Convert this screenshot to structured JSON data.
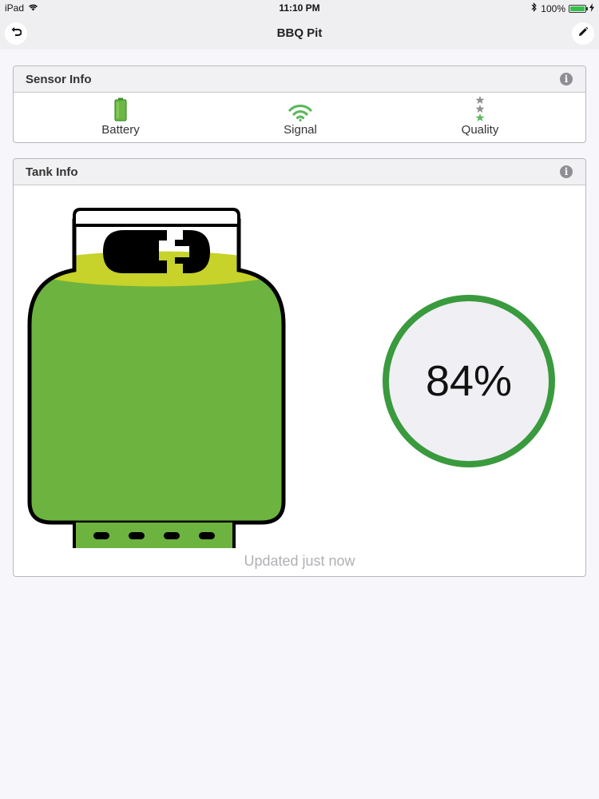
{
  "status_bar": {
    "device": "iPad",
    "time": "11:10 PM",
    "battery_percent": "100%",
    "icons": [
      "wifi-icon",
      "bluetooth-icon",
      "battery-icon",
      "charging-icon"
    ]
  },
  "nav": {
    "title": "BBQ Pit",
    "left_icon": "back-icon",
    "right_icon": "edit-pencil-icon"
  },
  "sensor_info": {
    "title": "Sensor Info",
    "items": [
      {
        "label": "Battery",
        "icon": "battery-level-icon"
      },
      {
        "label": "Signal",
        "icon": "wifi-signal-icon"
      },
      {
        "label": "Quality",
        "icon": "quality-stars-icon"
      }
    ]
  },
  "tank_info": {
    "title": "Tank Info",
    "level_percent": 84,
    "level_text": "84%",
    "updated_text": "Updated just now"
  },
  "colors": {
    "accent_green": "#3a9a3e",
    "tank_fill": "#6db33f",
    "tank_surface": "#c7d22a",
    "icon_green": "#5cb85c"
  }
}
